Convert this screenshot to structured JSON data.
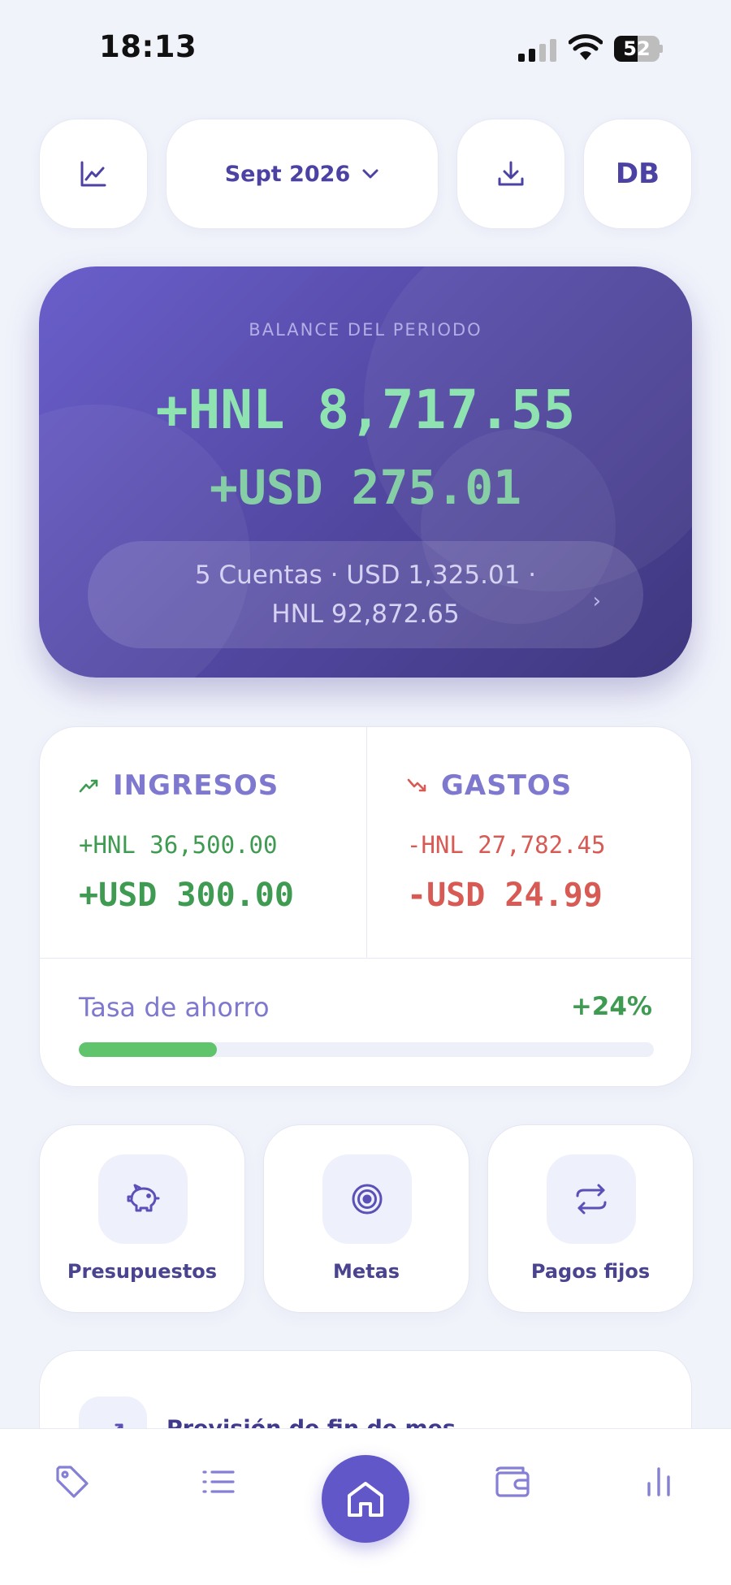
{
  "status_bar": {
    "time": "18:13",
    "battery": "52",
    "battery_level": 0.52
  },
  "toolbar": {
    "chart_icon": "line-chart-icon",
    "month_label": "Sept 2026",
    "download_icon": "download-icon",
    "avatar_initials": "DB"
  },
  "balance": {
    "label": "BALANCE DEL PERIODO",
    "hnl": "+HNL 8,717.55",
    "usd": "+USD 275.01",
    "accounts_line1": "5 Cuentas · USD 1,325.01 ·",
    "accounts_line2": "HNL 92,872.65",
    "chevron": "›"
  },
  "income": {
    "title": "INGRESOS",
    "hnl": "+HNL 36,500.00",
    "usd": "+USD 300.00"
  },
  "expenses": {
    "title": "GASTOS",
    "hnl": "-HNL 27,782.45",
    "usd": "-USD 24.99"
  },
  "savings": {
    "label": "Tasa de ahorro",
    "value": "+24%",
    "percent": 24
  },
  "quick_actions": [
    {
      "label": "Presupuestos",
      "icon": "piggy-bank-icon"
    },
    {
      "label": "Metas",
      "icon": "target-icon"
    },
    {
      "label": "Pagos fijos",
      "icon": "repeat-icon"
    }
  ],
  "forecast": {
    "title": "Previsión de fin de mes"
  },
  "bottom_nav": [
    {
      "icon": "tag-icon"
    },
    {
      "icon": "list-icon"
    },
    {
      "icon": "home-icon",
      "active": true
    },
    {
      "icon": "wallet-icon"
    },
    {
      "icon": "bar-chart-icon"
    }
  ],
  "colors": {
    "accent": "#6257c9",
    "income": "#3f9a52",
    "expense": "#d85a54",
    "balance_green": "#8ee3b0"
  }
}
